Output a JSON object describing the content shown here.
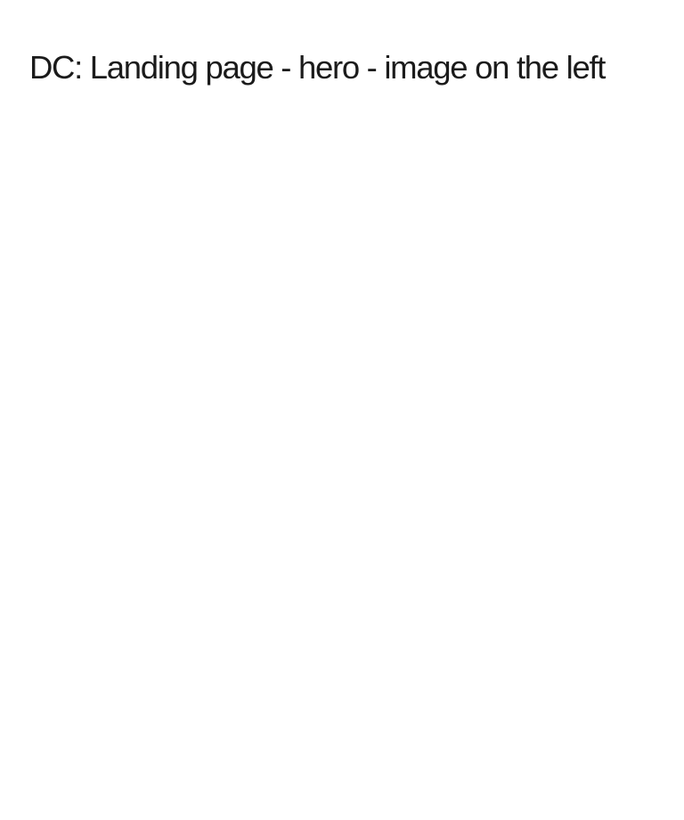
{
  "page": {
    "title": "DC: Landing page - hero - image on the left",
    "background_color": "#ffffff",
    "text_color": "#1b1b1b"
  }
}
